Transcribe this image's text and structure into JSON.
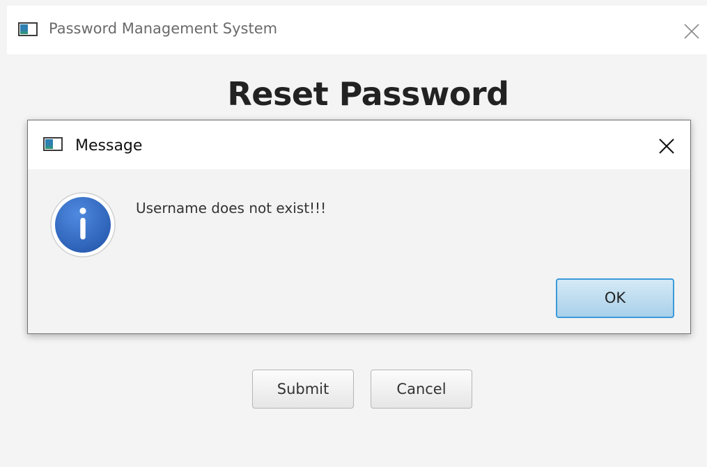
{
  "main_window": {
    "title": "Password Management System",
    "heading": "Reset Password",
    "buttons": {
      "submit_label": "Submit",
      "cancel_label": "Cancel"
    },
    "icons": {
      "app": "java-window-icon",
      "close": "close-icon"
    }
  },
  "dialog": {
    "title": "Message",
    "message": "Username does not exist!!!",
    "ok_label": "OK",
    "icons": {
      "app": "java-window-icon",
      "info": "info-icon",
      "close": "close-icon"
    }
  },
  "colors": {
    "window_background": "#f4f4f4",
    "titlebar_background": "#ffffff",
    "info_icon_blue": "#2d64b8",
    "ok_button_border": "#3c9ad8",
    "ok_button_fill": "#a9d0ea"
  }
}
